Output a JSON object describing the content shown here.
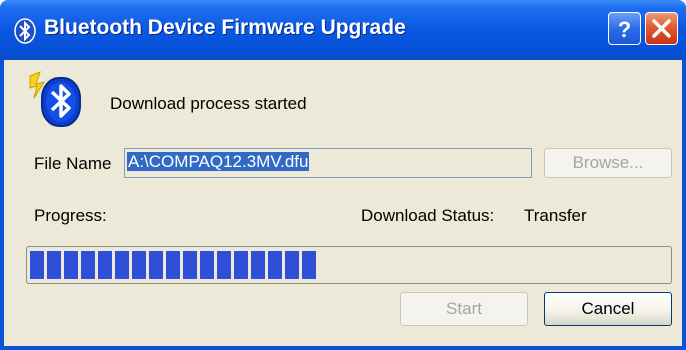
{
  "window": {
    "title": "Bluetooth Device Firmware Upgrade",
    "title_icon": "bluetooth-icon",
    "help_label": "?",
    "close_label": "×"
  },
  "status": {
    "message": "Download process started",
    "icon": "bluetooth-device-icon"
  },
  "file": {
    "label": "File Name",
    "value": "A:\\COMPAQ12.3MV.dfu",
    "browse_label": "Browse..."
  },
  "progress": {
    "label": "Progress:",
    "percent": 45,
    "download_status_label": "Download Status:",
    "download_status_value": "Transfer"
  },
  "buttons": {
    "start_label": "Start",
    "cancel_label": "Cancel"
  },
  "colors": {
    "titlebar": "#0a58e2",
    "client_bg": "#ece9d8",
    "progress_block": "#2f4fd8",
    "selection": "#316ac5"
  }
}
